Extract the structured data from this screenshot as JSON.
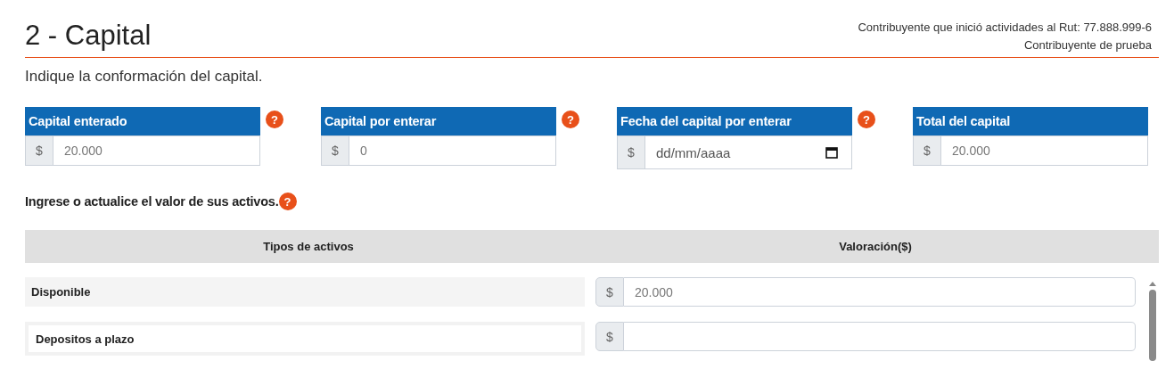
{
  "header": {
    "title": "2 - Capital",
    "taxpayer_line": "Contribuyente que inició actividades al Rut: 77.888.999-6",
    "taxpayer_name": "Contribuyente de prueba"
  },
  "intro": "Indique la conformación del capital.",
  "capital_fields": [
    {
      "kind": "number",
      "label": "Capital enterado",
      "prefix": "$",
      "value": "20.000",
      "help": "?"
    },
    {
      "kind": "number",
      "label": "Capital por enterar",
      "prefix": "$",
      "value": "0",
      "help": "?"
    },
    {
      "kind": "date",
      "label": "Fecha del capital por enterar",
      "prefix": "$",
      "placeholder": "dd/mm/aaaa",
      "help": "?"
    },
    {
      "kind": "number",
      "label": "Total del capital",
      "prefix": "$",
      "value": "20.000"
    }
  ],
  "assets_prompt": {
    "text": "Ingrese o actualice el valor de sus activos.",
    "help": "?"
  },
  "assets_table": {
    "columns": [
      "Tipos de activos",
      "Valoración($)"
    ],
    "rows": [
      {
        "type": "Disponible",
        "prefix": "$",
        "value": "20.000",
        "selected": false
      },
      {
        "type": "Depositos a plazo",
        "prefix": "$",
        "selected": true
      }
    ]
  }
}
